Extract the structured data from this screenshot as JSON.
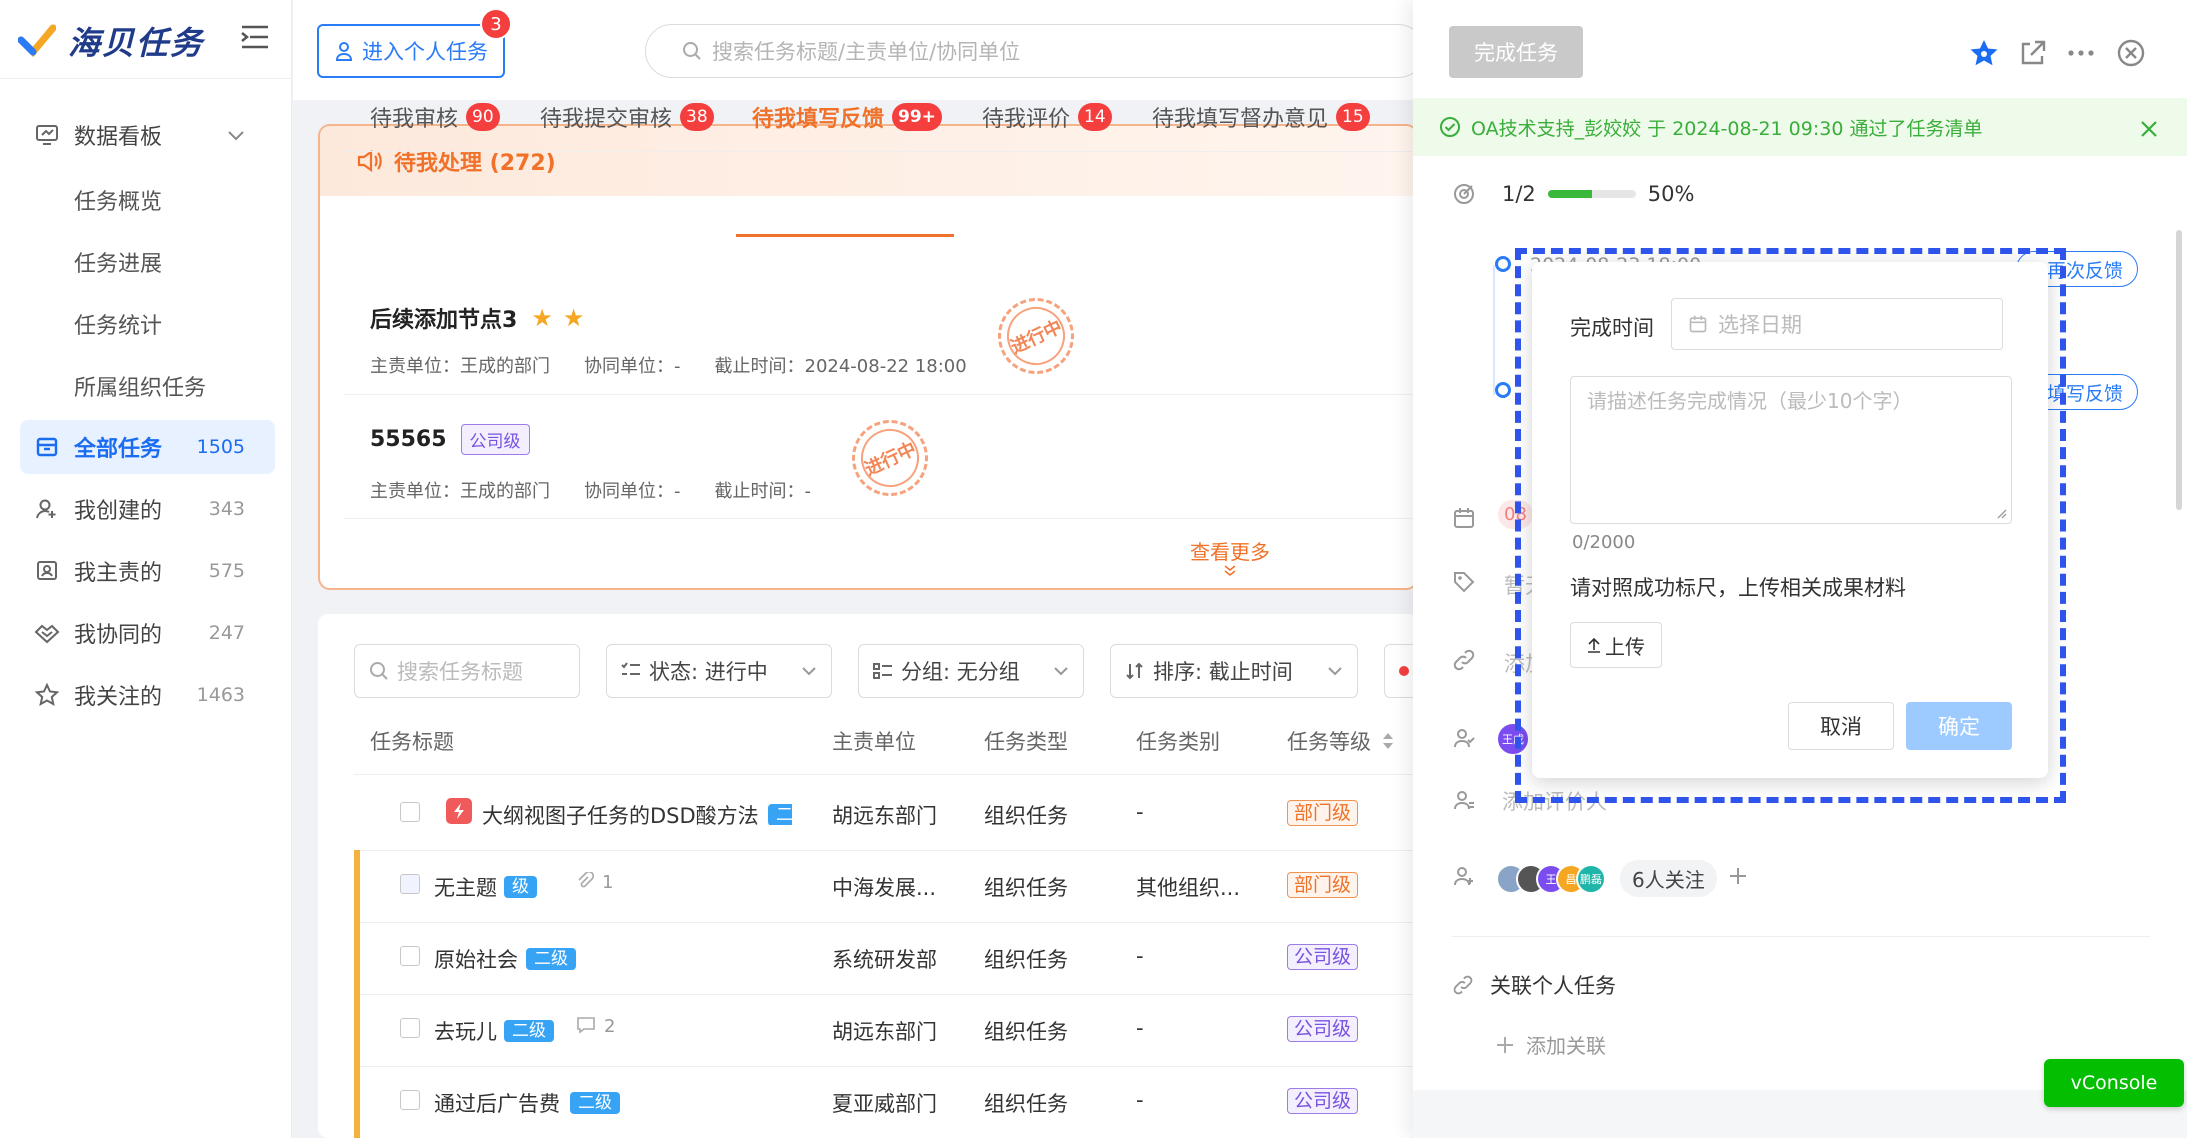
{
  "app": {
    "name": "海贝任务"
  },
  "topbar": {
    "enter_label": "进入个人任务",
    "enter_badge": "3",
    "search_placeholder": "搜索任务标题/主责单位/协同单位"
  },
  "sidebar": {
    "dashboard": "数据看板",
    "sub_items": [
      "任务概览",
      "任务进展",
      "任务统计",
      "所属组织任务"
    ],
    "items": [
      {
        "label": "全部任务",
        "count": "1505"
      },
      {
        "label": "我创建的",
        "count": "343"
      },
      {
        "label": "我主责的",
        "count": "575"
      },
      {
        "label": "我协同的",
        "count": "247"
      },
      {
        "label": "我关注的",
        "count": "1463"
      }
    ]
  },
  "pending": {
    "title": "待我处理 (272)",
    "tabs": [
      {
        "label": "待我审核",
        "badge": "90"
      },
      {
        "label": "待我提交审核",
        "badge": "38"
      },
      {
        "label": "待我填写反馈",
        "badge": "99+"
      },
      {
        "label": "待我评价",
        "badge": "14"
      },
      {
        "label": "待我填写督办意见",
        "badge": "15"
      }
    ],
    "items": [
      {
        "title": "后续添加节点3",
        "stars": "★",
        "owner": "主责单位：王成的部门",
        "coop": "协同单位：-",
        "deadline": "截止时间：2024-08-22 18:00",
        "stamp": "进行中"
      },
      {
        "title": "55565",
        "tag": "公司级",
        "owner": "主责单位：王成的部门",
        "coop": "协同单位：-",
        "deadline": "截止时间：-",
        "stamp": "进行中"
      }
    ],
    "more": "查看更多"
  },
  "list": {
    "search_placeholder": "搜索任务标题",
    "filters": {
      "status": "状态: 进行中",
      "group": "分组: 无分组",
      "sort": "排序: 截止时间"
    },
    "headers": [
      "任务标题",
      "主责单位",
      "任务类型",
      "任务类别",
      "任务等级"
    ],
    "rows": [
      {
        "title": "大纲视图子任务的DSD酸方法",
        "level": "二级",
        "unit": "胡远东部门",
        "type": "组织任务",
        "category": "-",
        "grade": "部门级"
      },
      {
        "title": "无主题",
        "level": "级",
        "attach": "1",
        "unit": "中海发展...",
        "type": "组织任务",
        "category": "其他组织...",
        "grade": "部门级"
      },
      {
        "title": "原始社会",
        "level": "二级",
        "unit": "系统研发部",
        "type": "组织任务",
        "category": "-",
        "grade": "公司级"
      },
      {
        "title": "去玩儿",
        "level": "二级",
        "comments": "2",
        "unit": "胡远东部门",
        "type": "组织任务",
        "category": "-",
        "grade": "公司级"
      },
      {
        "title": "通过后广告费",
        "level": "二级",
        "unit": "夏亚威部门",
        "type": "组织任务",
        "category": "-",
        "grade": "公司级"
      }
    ]
  },
  "drawer": {
    "complete_label": "完成任务",
    "notice": "OA技术支持_彭姣姣 于 2024-08-21 09:30 通过了任务清单",
    "progress_text": "1/2",
    "progress_percent": "50%",
    "progress_value": 0.5,
    "timeline": [
      {
        "date": "2024-08-23 18:00",
        "action": "再次反馈"
      },
      {
        "action": "填写反馈"
      }
    ],
    "faded_partial": {
      "date_tag": "08",
      "tag_row": "暂无",
      "link_row": "添加",
      "eval_row": "添加评价人"
    },
    "avatar_label": "王成",
    "follow_avatars": [
      "王",
      "昌",
      "鹏磊"
    ],
    "follow_count": "6人关注",
    "related_label": "关联个人任务",
    "add_related": "添加关联",
    "vconsole": "vConsole"
  },
  "popup": {
    "time_label": "完成时间",
    "date_placeholder": "选择日期",
    "textarea_placeholder": "请描述任务完成情况（最少10个字）",
    "char_count": "0/2000",
    "hint": "请对照成功标尺，上传相关成果材料",
    "upload_label": "上传",
    "cancel": "取消",
    "ok": "确定"
  },
  "colors": {
    "accent": "#1a6cf2",
    "orange": "#f0722a",
    "green": "#3ab83a",
    "dash": "#2f54eb"
  }
}
